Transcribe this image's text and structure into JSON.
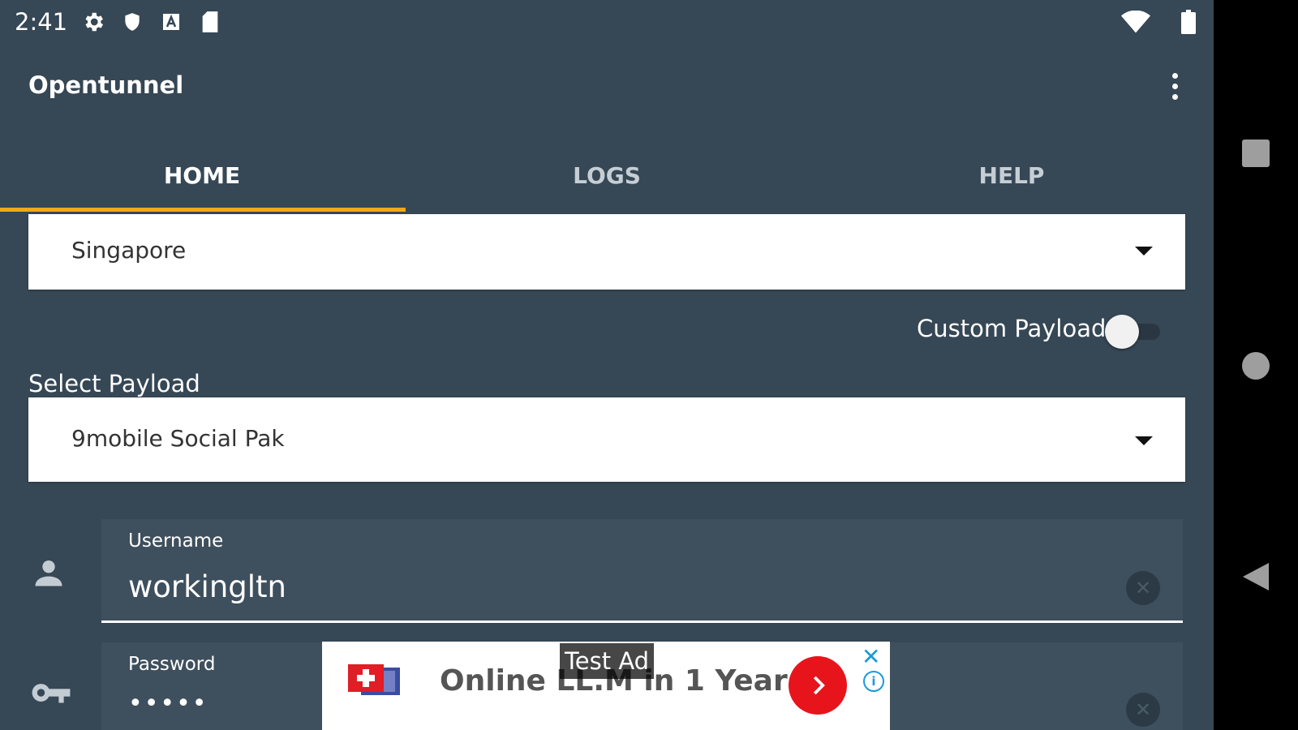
{
  "status_bar": {
    "time": "2:41"
  },
  "app_bar": {
    "title": "Opentunnel"
  },
  "tabs": [
    {
      "label": "HOME",
      "active": true
    },
    {
      "label": "LOGS",
      "active": false
    },
    {
      "label": "HELP",
      "active": false
    }
  ],
  "server_select": {
    "value": "Singapore"
  },
  "custom_payload": {
    "label": "Custom Payload",
    "enabled": false
  },
  "payload_select": {
    "label": "Select Payload",
    "value": "9mobile Social Pak"
  },
  "username_field": {
    "label": "Username",
    "value": "workingltn"
  },
  "password_field": {
    "label": "Password",
    "value": "•••••"
  },
  "ad": {
    "badge": "Test Ad",
    "text": "Online LL.M in 1 Year"
  },
  "colors": {
    "background": "#364755",
    "accent": "#f2a71b",
    "ad_button": "#e8141c"
  }
}
